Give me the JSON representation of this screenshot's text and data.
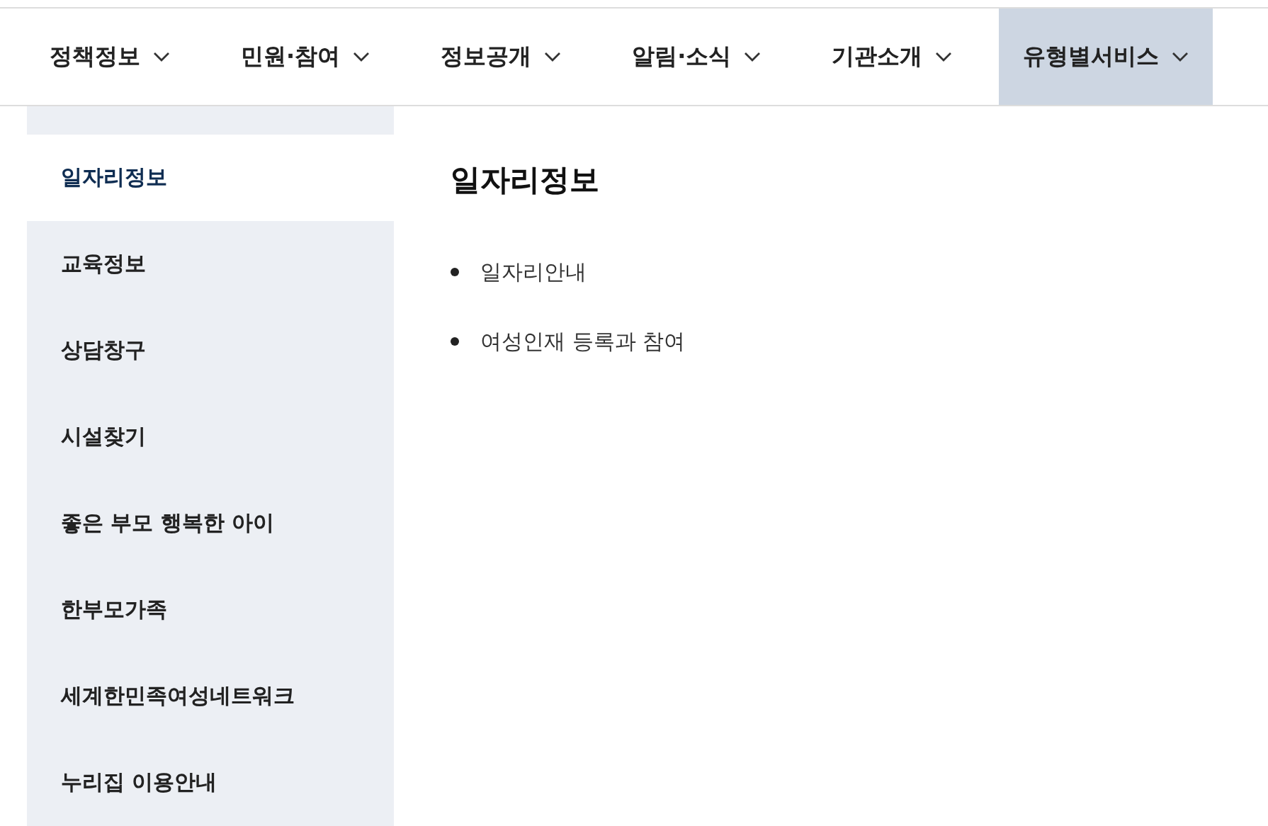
{
  "nav": [
    {
      "label": "정책정보",
      "selected": false
    },
    {
      "label": "민원·참여",
      "selected": false
    },
    {
      "label": "정보공개",
      "selected": false
    },
    {
      "label": "알림·소식",
      "selected": false
    },
    {
      "label": "기관소개",
      "selected": false
    },
    {
      "label": "유형별서비스",
      "selected": true
    }
  ],
  "sidebar": {
    "items": [
      {
        "label": "일자리정보",
        "selected": true
      },
      {
        "label": "교육정보",
        "selected": false
      },
      {
        "label": "상담창구",
        "selected": false
      },
      {
        "label": "시설찾기",
        "selected": false
      },
      {
        "label": "좋은 부모 행복한 아이",
        "selected": false
      },
      {
        "label": "한부모가족",
        "selected": false
      },
      {
        "label": "세계한민족여성네트워크",
        "selected": false
      },
      {
        "label": "누리집 이용안내",
        "selected": false
      }
    ]
  },
  "content": {
    "title": "일자리정보",
    "links": [
      "일자리안내",
      "여성인재 등록과 참여"
    ]
  }
}
